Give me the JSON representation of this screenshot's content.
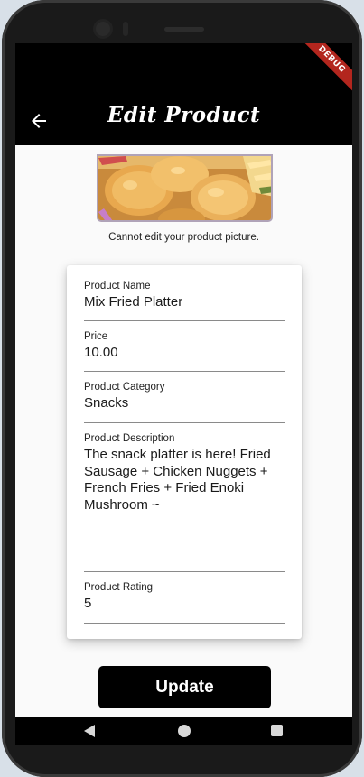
{
  "appbar": {
    "title": "Edit Product",
    "debug_banner": "DEBUG",
    "back_icon": "arrow-left-icon"
  },
  "product_image": {
    "note": "Cannot edit your product picture."
  },
  "form": {
    "product_name": {
      "label": "Product Name",
      "value": "Mix Fried Platter"
    },
    "price": {
      "label": "Price",
      "value": "10.00"
    },
    "category": {
      "label": "Product Category",
      "value": "Snacks"
    },
    "description": {
      "label": "Product Description",
      "value": "The snack platter is here! Fried Sausage + Chicken Nuggets + French Fries + Fried Enoki Mushroom ~"
    },
    "rating": {
      "label": "Product Rating",
      "value": "5"
    }
  },
  "actions": {
    "update_label": "Update"
  },
  "system_nav": {
    "back_icon": "triangle-back-icon",
    "home_icon": "circle-home-icon",
    "recents_icon": "square-recents-icon"
  },
  "colors": {
    "appbar": "#000000",
    "background": "#fafafa",
    "button": "#000000",
    "debug_ribbon": "#b3261e"
  }
}
